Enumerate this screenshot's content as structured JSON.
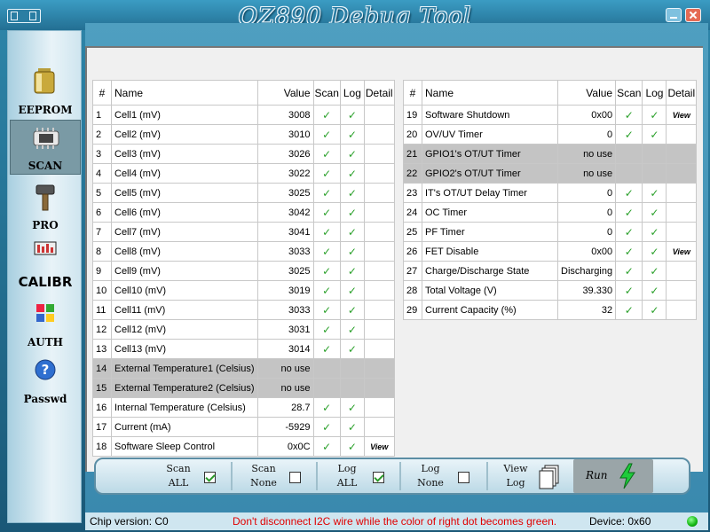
{
  "window": {
    "title": "OZ890 Debug Tool"
  },
  "sidebar": {
    "items": [
      {
        "label": "EEPROM",
        "icon": "battery-icon",
        "active": false
      },
      {
        "label": "SCAN",
        "icon": "chip-icon",
        "active": true
      },
      {
        "label": "PRO",
        "icon": "hammer-icon",
        "active": false
      },
      {
        "label": "CALIBR",
        "icon": "meter-icon",
        "active": false
      },
      {
        "label": "AUTH",
        "icon": "windows-logo-icon",
        "active": false
      },
      {
        "label": "Passwd",
        "icon": "question-icon",
        "active": false
      }
    ]
  },
  "table": {
    "headers": [
      "#",
      "Name",
      "Value",
      "Scan",
      "Log",
      "Detail"
    ],
    "view_label": "View",
    "left_rows": [
      {
        "n": "1",
        "name": "Cell1 (mV)",
        "value": "3008",
        "scan": true,
        "log": true,
        "detail": ""
      },
      {
        "n": "2",
        "name": "Cell2 (mV)",
        "value": "3010",
        "scan": true,
        "log": true,
        "detail": ""
      },
      {
        "n": "3",
        "name": "Cell3 (mV)",
        "value": "3026",
        "scan": true,
        "log": true,
        "detail": ""
      },
      {
        "n": "4",
        "name": "Cell4 (mV)",
        "value": "3022",
        "scan": true,
        "log": true,
        "detail": ""
      },
      {
        "n": "5",
        "name": "Cell5 (mV)",
        "value": "3025",
        "scan": true,
        "log": true,
        "detail": ""
      },
      {
        "n": "6",
        "name": "Cell6 (mV)",
        "value": "3042",
        "scan": true,
        "log": true,
        "detail": ""
      },
      {
        "n": "7",
        "name": "Cell7 (mV)",
        "value": "3041",
        "scan": true,
        "log": true,
        "detail": ""
      },
      {
        "n": "8",
        "name": "Cell8 (mV)",
        "value": "3033",
        "scan": true,
        "log": true,
        "detail": ""
      },
      {
        "n": "9",
        "name": "Cell9 (mV)",
        "value": "3025",
        "scan": true,
        "log": true,
        "detail": ""
      },
      {
        "n": "10",
        "name": "Cell10 (mV)",
        "value": "3019",
        "scan": true,
        "log": true,
        "detail": ""
      },
      {
        "n": "11",
        "name": "Cell11 (mV)",
        "value": "3033",
        "scan": true,
        "log": true,
        "detail": ""
      },
      {
        "n": "12",
        "name": "Cell12 (mV)",
        "value": "3031",
        "scan": true,
        "log": true,
        "detail": ""
      },
      {
        "n": "13",
        "name": "Cell13 (mV)",
        "value": "3014",
        "scan": true,
        "log": true,
        "detail": ""
      },
      {
        "n": "14",
        "name": "External Temperature1 (Celsius)",
        "value": "no use",
        "scan": false,
        "log": false,
        "detail": "",
        "nouse": true
      },
      {
        "n": "15",
        "name": "External Temperature2 (Celsius)",
        "value": "no use",
        "scan": false,
        "log": false,
        "detail": "",
        "nouse": true
      },
      {
        "n": "16",
        "name": "Internal Temperature (Celsius)",
        "value": "28.7",
        "scan": true,
        "log": true,
        "detail": ""
      },
      {
        "n": "17",
        "name": "Current (mA)",
        "value": "-5929",
        "scan": true,
        "log": true,
        "detail": ""
      },
      {
        "n": "18",
        "name": "Software Sleep Control",
        "value": "0x0C",
        "scan": true,
        "log": true,
        "detail": "View"
      }
    ],
    "right_rows": [
      {
        "n": "19",
        "name": "Software Shutdown",
        "value": "0x00",
        "scan": true,
        "log": true,
        "detail": "View"
      },
      {
        "n": "20",
        "name": "OV/UV Timer",
        "value": "0",
        "scan": true,
        "log": true,
        "detail": ""
      },
      {
        "n": "21",
        "name": "GPIO1's OT/UT Timer",
        "value": "no use",
        "scan": false,
        "log": false,
        "detail": "",
        "nouse": true
      },
      {
        "n": "22",
        "name": "GPIO2's OT/UT Timer",
        "value": "no use",
        "scan": false,
        "log": false,
        "detail": "",
        "nouse": true
      },
      {
        "n": "23",
        "name": "IT's OT/UT Delay Timer",
        "value": "0",
        "scan": true,
        "log": true,
        "detail": ""
      },
      {
        "n": "24",
        "name": "OC Timer",
        "value": "0",
        "scan": true,
        "log": true,
        "detail": ""
      },
      {
        "n": "25",
        "name": "PF Timer",
        "value": "0",
        "scan": true,
        "log": true,
        "detail": ""
      },
      {
        "n": "26",
        "name": "FET Disable",
        "value": "0x00",
        "scan": true,
        "log": true,
        "detail": "View"
      },
      {
        "n": "27",
        "name": "Charge/Discharge State",
        "value": "Discharging",
        "scan": true,
        "log": true,
        "detail": ""
      },
      {
        "n": "28",
        "name": "Total Voltage (V)",
        "value": "39.330",
        "scan": true,
        "log": true,
        "detail": ""
      },
      {
        "n": "29",
        "name": "Current Capacity (%)",
        "value": "32",
        "scan": true,
        "log": true,
        "detail": ""
      }
    ]
  },
  "toolbar": {
    "scan_all": {
      "line1": "Scan",
      "line2": "ALL",
      "checked": true
    },
    "scan_none": {
      "line1": "Scan",
      "line2": "None",
      "checked": false
    },
    "log_all": {
      "line1": "Log",
      "line2": "ALL",
      "checked": true
    },
    "log_none": {
      "line1": "Log",
      "line2": "None",
      "checked": false
    },
    "view_log": {
      "line1": "View",
      "line2": "Log"
    },
    "run": {
      "label": "Run"
    }
  },
  "status": {
    "chip_version": "Chip version: C0",
    "warning": "Don't disconnect I2C wire while the color of right dot becomes green.",
    "device": "Device: 0x60",
    "dot_color": "#22cc22"
  },
  "colors": {
    "accent": "#2a7ca2",
    "check": "#2aa02a",
    "warning": "#e00000"
  }
}
